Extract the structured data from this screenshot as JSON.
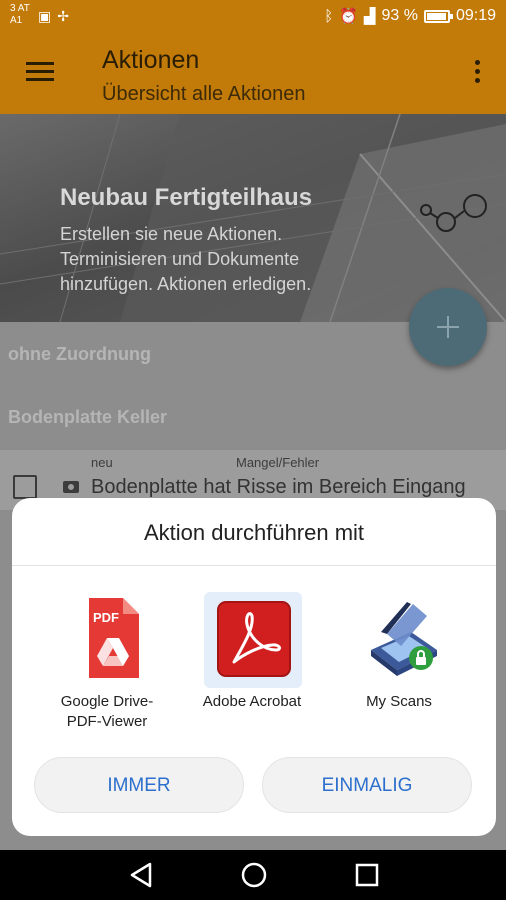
{
  "status_bar": {
    "carrier_line1": "3 AT",
    "carrier_line2": "A1",
    "battery_percent": "93 %",
    "battery_level": 0.93,
    "time": "09:19"
  },
  "app_bar": {
    "title": "Aktionen",
    "subtitle": "Übersicht alle Aktionen"
  },
  "hero": {
    "title": "Neubau Fertigteilhaus",
    "description": "Erstellen sie neue Aktionen. Terminisieren und Dokumente hinzufügen. Aktionen erledigen."
  },
  "groups": [
    {
      "label": "ohne Zuordnung"
    },
    {
      "label": "Bodenplatte Keller"
    }
  ],
  "item": {
    "status": "neu",
    "type": "Mangel/Fehler",
    "text": "Bodenplatte hat Risse im Bereich Eingang"
  },
  "dialog": {
    "title": "Aktion durchführen mit",
    "apps": [
      {
        "label": "Google Drive-\nPDF-Viewer",
        "icon": "google-drive-pdf-icon"
      },
      {
        "label": "Adobe Acrobat",
        "icon": "adobe-acrobat-icon",
        "selected": true
      },
      {
        "label": "My Scans",
        "icon": "my-scans-icon"
      }
    ],
    "always_label": "IMMER",
    "once_label": "EINMALIG"
  },
  "colors": {
    "app_bar": "#c27a08",
    "fab": "#4d6a77",
    "accent_text": "#2c6fcd",
    "pdf_red": "#e53935",
    "acrobat_red": "#d11f1f"
  }
}
